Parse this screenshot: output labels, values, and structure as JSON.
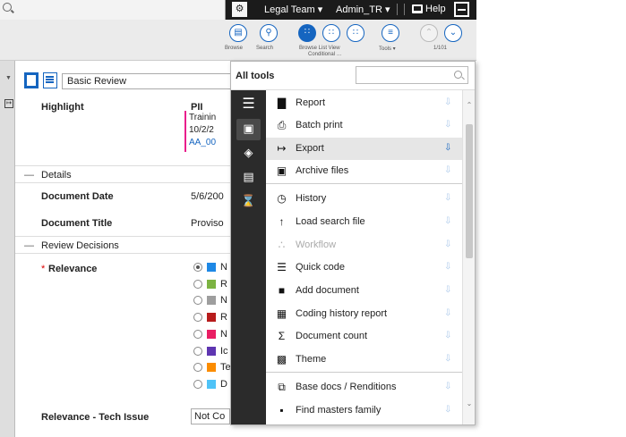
{
  "header": {
    "search_placeholder": "",
    "group": "Legal Team ▾",
    "user": "Admin_TR ▾",
    "help": "Help"
  },
  "toolbar": {
    "items": [
      {
        "label": "Browse",
        "icon": "browse-icon"
      },
      {
        "label": "Search",
        "icon": "search-icon"
      },
      {
        "label": "Browse List View",
        "sublabel": "Conditional …",
        "icon": "list-view-icon"
      },
      {
        "label": "Tools ▾",
        "icon": "tools-icon"
      },
      {
        "label": "1/101",
        "icon": "navigation-icon"
      }
    ]
  },
  "coding_form": {
    "form_name": "Basic Review",
    "highlight_label": "Highlight",
    "pii_label": "PII",
    "pii_lines": [
      "Trainin",
      "10/2/2",
      "AA_00"
    ],
    "details_section": "Details",
    "document_date_label": "Document Date",
    "document_date_value": "5/6/200",
    "document_title_label": "Document Title",
    "document_title_value": "Proviso",
    "review_section": "Review Decisions",
    "relevance_required": "*",
    "relevance_label": "Relevance",
    "relevance_options": [
      {
        "text": "N",
        "color": "#1e88e5",
        "selected": true
      },
      {
        "text": "R",
        "color": "#7cb342",
        "selected": false
      },
      {
        "text": "N",
        "color": "#9e9e9e",
        "selected": false
      },
      {
        "text": "R",
        "color": "#b71c1c",
        "selected": false
      },
      {
        "text": "N",
        "color": "#e91e63",
        "selected": false
      },
      {
        "text": "Ic",
        "color": "#5e35b1",
        "selected": false
      },
      {
        "text": "Te",
        "color": "#fb8c00",
        "selected": false
      },
      {
        "text": "D",
        "color": "#4fc3f7",
        "selected": false
      }
    ],
    "tech_issue_label": "Relevance - Tech Issue",
    "tech_issue_value": "Not Co"
  },
  "all_tools": {
    "title": "All tools",
    "search_placeholder": "",
    "categories": [
      {
        "icon": "menu-icon"
      },
      {
        "icon": "upload-icon"
      },
      {
        "icon": "layers-icon"
      },
      {
        "icon": "document-icon"
      },
      {
        "icon": "hourglass-icon"
      }
    ],
    "tools": [
      {
        "label": "Report",
        "icon": "report-icon",
        "glyph": "▇",
        "disabled": false,
        "pinned": false
      },
      {
        "label": "Batch print",
        "icon": "print-icon",
        "glyph": "⎙",
        "disabled": false,
        "pinned": false
      },
      {
        "label": "Export",
        "icon": "export-icon",
        "glyph": "↦",
        "disabled": false,
        "pinned": true
      },
      {
        "label": "Archive files",
        "icon": "archive-icon",
        "glyph": "▣",
        "disabled": false,
        "pinned": false
      },
      {
        "label": "History",
        "icon": "history-icon",
        "glyph": "◷",
        "disabled": false,
        "pinned": false
      },
      {
        "label": "Load search file",
        "icon": "load-search-icon",
        "glyph": "↑",
        "disabled": false,
        "pinned": false
      },
      {
        "label": "Workflow",
        "icon": "workflow-icon",
        "glyph": "∴",
        "disabled": true,
        "pinned": false
      },
      {
        "label": "Quick code",
        "icon": "quick-code-icon",
        "glyph": "☰",
        "disabled": false,
        "pinned": false
      },
      {
        "label": "Add document",
        "icon": "add-document-icon",
        "glyph": "■",
        "disabled": false,
        "pinned": false
      },
      {
        "label": "Coding history report",
        "icon": "coding-history-icon",
        "glyph": "▦",
        "disabled": false,
        "pinned": false
      },
      {
        "label": "Document count",
        "icon": "sigma-icon",
        "glyph": "Σ",
        "disabled": false,
        "pinned": false
      },
      {
        "label": "Theme",
        "icon": "theme-icon",
        "glyph": "▩",
        "disabled": false,
        "pinned": false
      },
      {
        "label": "Base docs / Renditions",
        "icon": "base-docs-icon",
        "glyph": "⧉",
        "disabled": false,
        "pinned": false
      },
      {
        "label": "Find masters family",
        "icon": "find-masters-icon",
        "glyph": "▪",
        "disabled": false,
        "pinned": false
      }
    ],
    "pin_glyph": "⇩",
    "accent": "#1565c0"
  }
}
